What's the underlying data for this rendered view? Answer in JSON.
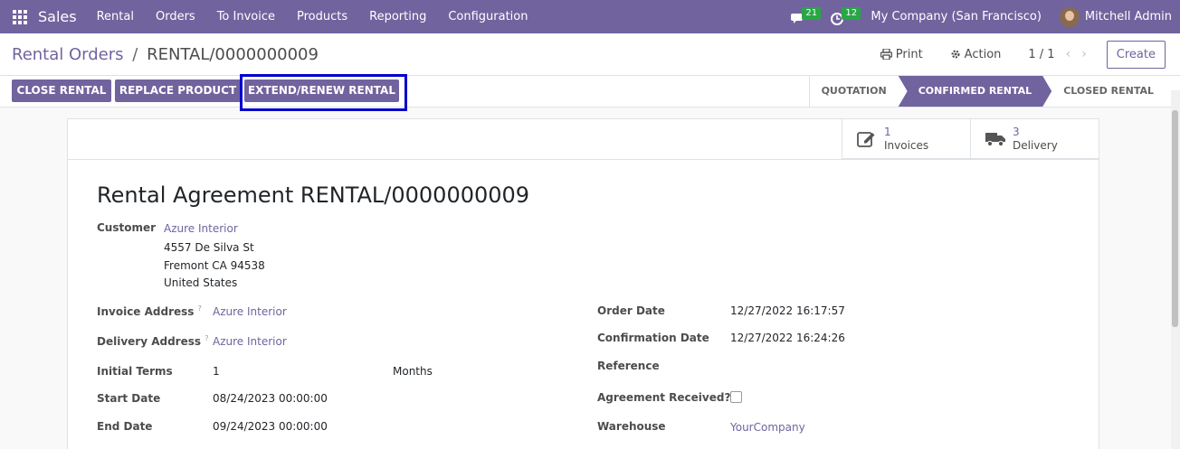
{
  "navbar": {
    "brand": "Sales",
    "menu": [
      "Rental",
      "Orders",
      "To Invoice",
      "Products",
      "Reporting",
      "Configuration"
    ],
    "messages_count": "21",
    "activities_count": "12",
    "company": "My Company (San Francisco)",
    "user": "Mitchell Admin"
  },
  "control_panel": {
    "breadcrumb_parent": "Rental Orders",
    "breadcrumb_sep": "/",
    "breadcrumb_current": "RENTAL/0000000009",
    "print_label": "Print",
    "action_label": "Action",
    "pager": "1 / 1",
    "prev_arrow": "‹",
    "next_arrow": "›",
    "create_label": "Create"
  },
  "status_bar": {
    "buttons": [
      "CLOSE RENTAL",
      "REPLACE PRODUCT",
      "EXTEND/RENEW RENTAL"
    ],
    "stages": [
      "QUOTATION",
      "CONFIRMED RENTAL",
      "CLOSED RENTAL"
    ],
    "active_stage": "CONFIRMED RENTAL"
  },
  "smart_buttons": {
    "invoices_count": "1",
    "invoices_label": "Invoices",
    "delivery_count": "3",
    "delivery_label": "Delivery"
  },
  "form": {
    "title": "Rental Agreement RENTAL/0000000009",
    "customer_label": "Customer",
    "customer_name": "Azure Interior",
    "customer_street": "4557 De Silva St",
    "customer_city": "Fremont CA 94538",
    "customer_country": "United States",
    "invoice_address_label": "Invoice Address",
    "invoice_address": "Azure Interior",
    "delivery_address_label": "Delivery Address",
    "delivery_address": "Azure Interior",
    "help_mark": "?",
    "initial_terms_label": "Initial Terms",
    "initial_terms": "1",
    "initial_terms_unit": "Months",
    "start_date_label": "Start Date",
    "start_date": "08/24/2023 00:00:00",
    "end_date_label": "End Date",
    "end_date": "09/24/2023 00:00:00",
    "order_date_label": "Order Date",
    "order_date": "12/27/2022 16:17:57",
    "confirmation_date_label": "Confirmation Date",
    "confirmation_date": "12/27/2022 16:24:26",
    "reference_label": "Reference",
    "agreement_received_label": "Agreement Received?",
    "agreement_received": false,
    "warehouse_label": "Warehouse",
    "warehouse": "YourCompany"
  },
  "colors": {
    "brand": "#71639e",
    "badge": "#28a745",
    "highlight": "#0000cc"
  }
}
